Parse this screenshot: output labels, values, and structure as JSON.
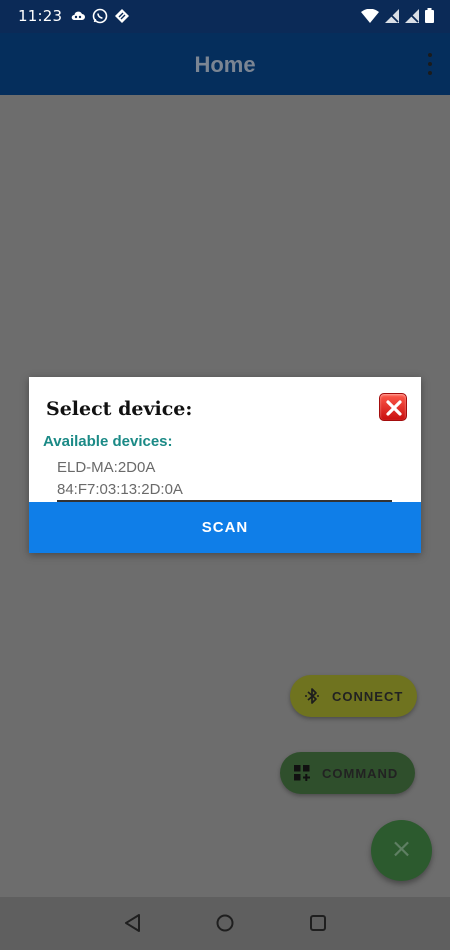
{
  "status_bar": {
    "time": "11:23",
    "left_icons": [
      "cloud-icon",
      "whatsapp-icon",
      "app-icon"
    ],
    "right_icons": [
      "wifi-icon",
      "signal-off-icon",
      "signal-off-icon",
      "battery-icon"
    ]
  },
  "app_bar": {
    "title": "Home",
    "menu_icon": "overflow-menu-icon"
  },
  "dialog": {
    "title": "Select device:",
    "close_icon": "close-icon",
    "available_label": "Available devices:",
    "devices": [
      {
        "name": "ELD-MA:2D0A",
        "address": "84:F7:03:13:2D:0A"
      }
    ],
    "scan_label": "SCAN"
  },
  "fabs": {
    "connect_label": "CONNECT",
    "connect_icon": "bluetooth-icon",
    "command_label": "COMMAND",
    "command_icon": "grid-add-icon",
    "main_icon": "close-icon",
    "main_symbol": "×"
  },
  "nav_bar": {
    "buttons": [
      "back-icon",
      "home-icon",
      "recents-icon"
    ]
  },
  "colors": {
    "status_bar": "#0b2a57",
    "app_bar": "#052e5c",
    "scrim_background": "#6d6d6d",
    "scan_button": "#0f7ee8",
    "available_label": "#1b8a86",
    "connect_fab": "#6f731f",
    "command_fab": "#2f4f2c",
    "main_fab": "#2c5a2e"
  }
}
